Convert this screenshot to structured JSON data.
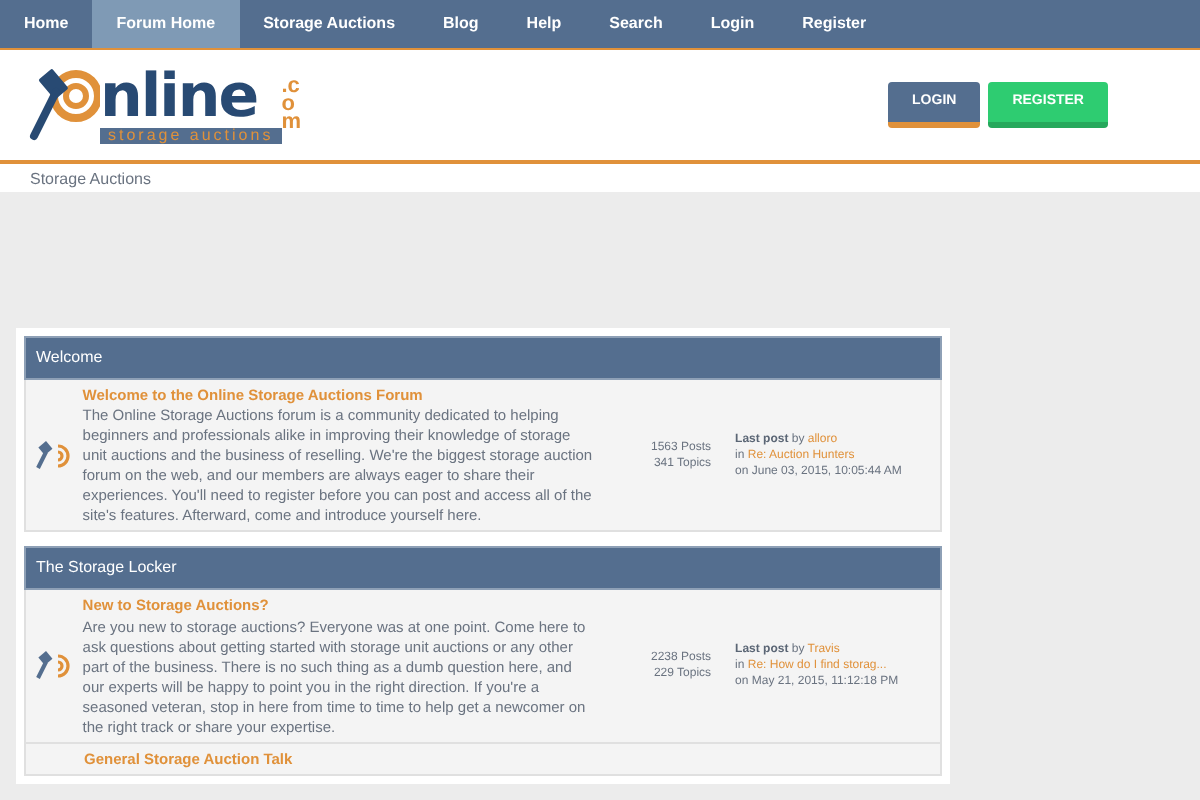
{
  "nav": [
    {
      "label": "Home",
      "selected": false
    },
    {
      "label": "Forum Home",
      "selected": true
    },
    {
      "label": "Storage Auctions",
      "selected": false
    },
    {
      "label": "Blog",
      "selected": false
    },
    {
      "label": "Help",
      "selected": false
    },
    {
      "label": "Search",
      "selected": false
    },
    {
      "label": "Login",
      "selected": false
    },
    {
      "label": "Register",
      "selected": false
    }
  ],
  "logo": {
    "word": "nline",
    "suffix": ".com",
    "tagline": "storage auctions"
  },
  "header_buttons": [
    {
      "label": "LOGIN",
      "kind": "login"
    },
    {
      "label": "REGISTER",
      "kind": "register"
    }
  ],
  "breadcrumb": "Storage Auctions",
  "categories": [
    {
      "title": "Welcome",
      "boards": [
        {
          "name": "Welcome to the Online Storage Auctions Forum",
          "description": "The Online Storage Auctions forum is a community dedicated to helping beginners and professionals alike in improving their knowledge of storage unit auctions and the business of reselling. We're the biggest storage auction forum on the web, and our members are always eager to share their experiences. You'll need to register before you can post and access all of the site's features. Afterward, come and introduce yourself here.",
          "posts": "1563 Posts",
          "topics": "341 Topics",
          "last_post": {
            "label": "Last post",
            "by": "by",
            "author": "alloro",
            "in": "in",
            "topic": "Re: Auction Hunters",
            "date": "on June 03, 2015, 10:05:44 AM"
          }
        }
      ]
    },
    {
      "title": "The Storage Locker",
      "boards": [
        {
          "name": "New to Storage Auctions?",
          "description": "Are you new to storage auctions? Everyone was at one point. Come here to ask questions about getting started with storage unit auctions or any other part of the business. There is no such thing as a dumb question here, and our experts will be happy to point you in the right direction. If you're a seasoned veteran, stop in here from time to time to help get a newcomer on the right track or share your expertise.",
          "posts": "2238 Posts",
          "topics": "229 Topics",
          "last_post": {
            "label": "Last post",
            "by": "by",
            "author": "Travis",
            "in": "in",
            "topic": "Re: How do I find storag...",
            "date": "on May 21, 2015, 11:12:18 PM"
          }
        },
        {
          "name": "General Storage Auction Talk"
        }
      ]
    }
  ]
}
